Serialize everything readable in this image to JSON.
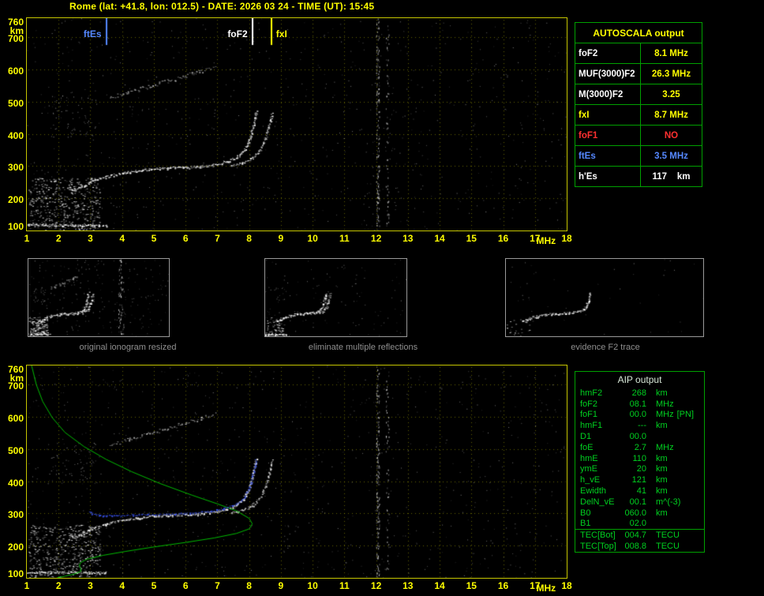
{
  "header": {
    "title": "Rome (lat: +41.8, lon: 012.5) - DATE: 2026 03 24 - TIME (UT): 15:45"
  },
  "colors": {
    "accent_yellow": "#ffff00",
    "panel_border_green": "#00a000",
    "aip_text_green": "#00d020",
    "marker_blue": "#5588ff",
    "alert_red": "#ff3030",
    "caption_gray": "#8f8f8f"
  },
  "autoscala": {
    "title": "AUTOSCALA output",
    "rows": [
      {
        "label": "foF2",
        "value": "8.1 MHz",
        "label_color": "#ffffff",
        "value_color": "#ffff00"
      },
      {
        "label": "MUF(3000)F2",
        "value": "26.3 MHz",
        "label_color": "#ffffff",
        "value_color": "#ffff00"
      },
      {
        "label": "M(3000)F2",
        "value": "3.25",
        "label_color": "#ffffff",
        "value_color": "#ffff00"
      },
      {
        "label": "fxI",
        "value": "8.7 MHz",
        "label_color": "#ffff00",
        "value_color": "#ffff00"
      },
      {
        "label": "foF1",
        "value": "NO",
        "label_color": "#ff3030",
        "value_color": "#ff3030"
      },
      {
        "label": "ftEs",
        "value": "3.5 MHz",
        "label_color": "#5588ff",
        "value_color": "#5588ff"
      },
      {
        "label": "h'Es",
        "value": "117    km",
        "label_color": "#ffffff",
        "value_color": "#ffffff"
      }
    ]
  },
  "aip": {
    "title": "AIP output",
    "rows": [
      {
        "name": "hmF2",
        "value": "268",
        "unit": "km",
        "extra": ""
      },
      {
        "name": "foF2",
        "value": "08.1",
        "unit": "MHz",
        "extra": ""
      },
      {
        "name": "foF1",
        "value": "00.0",
        "unit": "MHz",
        "extra": "[PN]"
      },
      {
        "name": "hmF1",
        "value": "---",
        "unit": "km",
        "extra": ""
      },
      {
        "name": "D1",
        "value": "00.0",
        "unit": "",
        "extra": ""
      },
      {
        "name": "foE",
        "value": "2.7",
        "unit": "MHz",
        "extra": ""
      },
      {
        "name": "hmE",
        "value": "110",
        "unit": "km",
        "extra": ""
      },
      {
        "name": "ymE",
        "value": "20",
        "unit": "km",
        "extra": ""
      },
      {
        "name": "h_vE",
        "value": "121",
        "unit": "km",
        "extra": ""
      },
      {
        "name": "Ewidth",
        "value": "41",
        "unit": "km",
        "extra": ""
      },
      {
        "name": "DelN_vE",
        "value": "00.1",
        "unit": "m^(-3)",
        "extra": ""
      },
      {
        "name": "B0",
        "value": "060.0",
        "unit": "km",
        "extra": ""
      },
      {
        "name": "B1",
        "value": "02.0",
        "unit": "",
        "extra": ""
      }
    ],
    "tec_rows": [
      {
        "name": "TEC[Bot]",
        "value": "004.7",
        "unit": "TECU"
      },
      {
        "name": "TEC[Top]",
        "value": "008.8",
        "unit": "TECU"
      }
    ]
  },
  "thumbnails": [
    {
      "caption": "original ionogram resized"
    },
    {
      "caption": "eliminate multiple reflections"
    },
    {
      "caption": "evidence F2 trace"
    }
  ],
  "chart_data": {
    "type": "scatter",
    "description": "Ionosonde ionogram: echo virtual height (km) vs sounding frequency (MHz); two large panels (raw autoscaled ionogram with ftEs/foF2/fxI markers, and ionogram with restored trace + electron density profile) plus three processing-step thumbnails",
    "x_label": "MHz",
    "y_label": "km",
    "x_range": [
      1,
      18
    ],
    "y_range": [
      100,
      760
    ],
    "grid": true,
    "x_ticks": [
      "1",
      "2",
      "3",
      "4",
      "5",
      "6",
      "7",
      "8",
      "9",
      "10",
      "11",
      "12",
      "13",
      "14",
      "15",
      "16",
      "17",
      "18"
    ],
    "y_ticks": [
      "760",
      "700",
      "600",
      "500",
      "400",
      "300",
      "200",
      "100"
    ],
    "markers": [
      {
        "label": "ftEs",
        "freq_mhz": 3.5,
        "color": "#5588ff"
      },
      {
        "label": "foF2",
        "freq_mhz": 8.1,
        "color": "#ffffff"
      },
      {
        "label": "fxI",
        "freq_mhz": 8.7,
        "color": "#ffff00"
      }
    ],
    "traces": {
      "es_layer": [
        [
          1.0,
          118
        ],
        [
          3.5,
          117
        ]
      ],
      "f2_ordinary": [
        [
          2.3,
          236
        ],
        [
          2.5,
          228
        ],
        [
          2.8,
          240
        ],
        [
          3.1,
          256
        ],
        [
          3.5,
          268
        ],
        [
          4.0,
          279
        ],
        [
          4.5,
          287
        ],
        [
          5.0,
          292
        ],
        [
          5.5,
          295
        ],
        [
          6.0,
          297
        ],
        [
          6.5,
          300
        ],
        [
          7.0,
          307
        ],
        [
          7.3,
          315
        ],
        [
          7.6,
          328
        ],
        [
          7.8,
          345
        ],
        [
          7.95,
          368
        ],
        [
          8.05,
          398
        ],
        [
          8.13,
          430
        ],
        [
          8.18,
          455
        ],
        [
          8.21,
          472
        ]
      ],
      "f2_extraordinary": [
        [
          7.4,
          302
        ],
        [
          7.8,
          311
        ],
        [
          8.1,
          326
        ],
        [
          8.35,
          352
        ],
        [
          8.5,
          385
        ],
        [
          8.6,
          418
        ],
        [
          8.68,
          448
        ],
        [
          8.72,
          468
        ]
      ],
      "second_hop": [
        [
          3.6,
          512
        ],
        [
          4.2,
          530
        ],
        [
          4.8,
          548
        ],
        [
          5.4,
          565
        ],
        [
          6.0,
          582
        ],
        [
          6.5,
          597
        ],
        [
          6.9,
          610
        ]
      ],
      "interference_lines_mhz": [
        12.05,
        12.35
      ]
    },
    "profile_green": [
      [
        1.15,
        760
      ],
      [
        1.3,
        700
      ],
      [
        1.5,
        648
      ],
      [
        1.8,
        598
      ],
      [
        2.2,
        552
      ],
      [
        2.8,
        508
      ],
      [
        3.5,
        468
      ],
      [
        4.3,
        430
      ],
      [
        5.2,
        393
      ],
      [
        6.2,
        357
      ],
      [
        7.0,
        330
      ],
      [
        7.6,
        308
      ],
      [
        8.0,
        285
      ],
      [
        8.1,
        268
      ],
      [
        8.0,
        252
      ],
      [
        7.6,
        238
      ],
      [
        6.9,
        224
      ],
      [
        6.0,
        210
      ],
      [
        5.0,
        196
      ],
      [
        4.1,
        182
      ],
      [
        3.4,
        170
      ],
      [
        2.9,
        158
      ],
      [
        2.7,
        148
      ],
      [
        2.65,
        138
      ],
      [
        2.7,
        128
      ],
      [
        2.7,
        120
      ],
      [
        2.5,
        112
      ],
      [
        2.2,
        105
      ],
      [
        1.95,
        100
      ]
    ],
    "fitted_trace_blue": [
      [
        2.95,
        308
      ],
      [
        3.1,
        299
      ],
      [
        3.4,
        294
      ],
      [
        3.8,
        294
      ],
      [
        4.3,
        296
      ],
      [
        5.0,
        298
      ],
      [
        5.7,
        300
      ],
      [
        6.3,
        303
      ],
      [
        6.8,
        308
      ],
      [
        7.2,
        316
      ],
      [
        7.6,
        331
      ],
      [
        7.85,
        352
      ],
      [
        8.0,
        382
      ],
      [
        8.1,
        418
      ],
      [
        8.17,
        450
      ],
      [
        8.2,
        468
      ]
    ],
    "overlays": {
      "profile_color": "#00bc00",
      "fitted_color": "#3b55f0"
    }
  }
}
